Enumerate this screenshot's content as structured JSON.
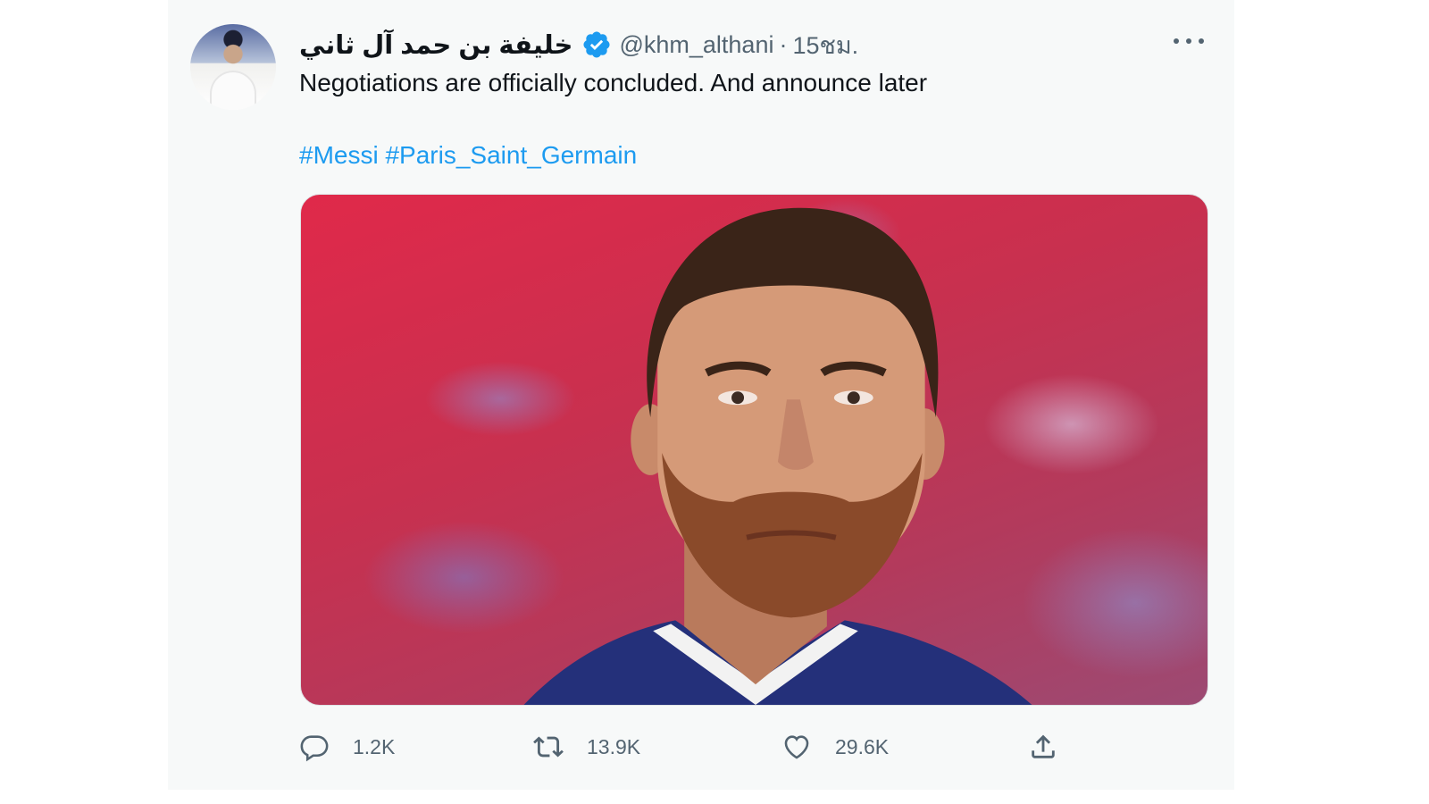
{
  "tweet": {
    "display_name": "خليفة بن حمد آل ثاني",
    "handle": "@khm_althani",
    "separator": "·",
    "timestamp": "15ชม.",
    "verified": true,
    "text": "Negotiations are officially concluded. And announce later",
    "hashtags": [
      "#Messi",
      "#Paris_Saint_Germain"
    ],
    "media_description_icon": "photo",
    "stats": {
      "replies": "1.2K",
      "retweets": "13.9K",
      "likes": "29.6K"
    }
  },
  "icons": {
    "verified": "verified-badge-icon",
    "more": "more-options-icon",
    "reply": "reply-icon",
    "retweet": "retweet-icon",
    "like": "heart-icon",
    "share": "share-icon"
  },
  "colors": {
    "accent": "#1d9bf0",
    "text": "#0f1419",
    "secondary": "#536471",
    "card_background": "#f7f9f9"
  }
}
